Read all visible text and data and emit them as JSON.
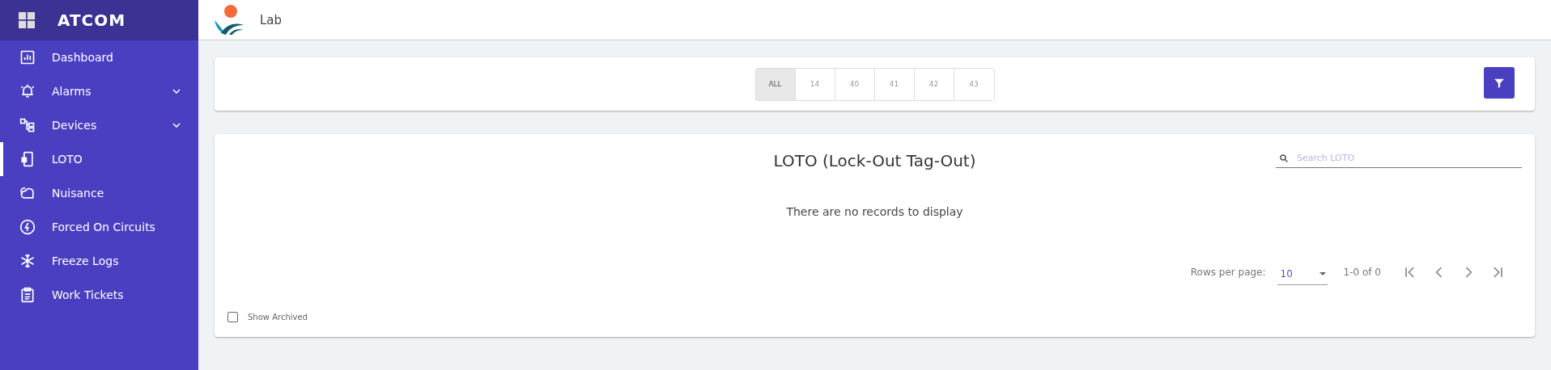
{
  "sidebar": {
    "brand": "ATCOM",
    "items": [
      {
        "label": "Dashboard",
        "expandable": false,
        "selected": false
      },
      {
        "label": "Alarms",
        "expandable": true,
        "selected": false
      },
      {
        "label": "Devices",
        "expandable": true,
        "selected": false
      },
      {
        "label": "LOTO",
        "expandable": false,
        "selected": true
      },
      {
        "label": "Nuisance",
        "expandable": false,
        "selected": false
      },
      {
        "label": "Forced On Circuits",
        "expandable": false,
        "selected": false
      },
      {
        "label": "Freeze Logs",
        "expandable": false,
        "selected": false
      },
      {
        "label": "Work Tickets",
        "expandable": false,
        "selected": false
      }
    ]
  },
  "header": {
    "title": "Lab"
  },
  "filters": [
    {
      "label": "ALL",
      "selected": true
    },
    {
      "label": "14",
      "selected": false
    },
    {
      "label": "40",
      "selected": false
    },
    {
      "label": "41",
      "selected": false
    },
    {
      "label": "42",
      "selected": false
    },
    {
      "label": "43",
      "selected": false
    }
  ],
  "table": {
    "title": "LOTO (Lock-Out Tag-Out)",
    "search": {
      "placeholder": "Search LOTO"
    },
    "empty_message": "There are no records to display",
    "pagination": {
      "rows_per_page_label": "Rows per page:",
      "rows_per_page": "10",
      "range": "1-0 of 0"
    },
    "show_archived": {
      "label": "Show Archived",
      "checked": false
    }
  }
}
